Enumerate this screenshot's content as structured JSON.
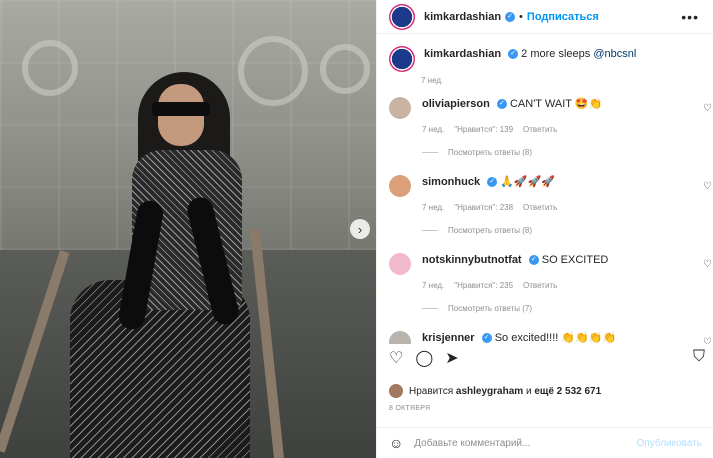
{
  "post": {
    "username": "kimkardashian",
    "follow_label": "Подписаться",
    "more_label": "•••",
    "caption_text": "2 more sleeps",
    "caption_mention": "@nbcsnl",
    "caption_time": "7 нед.",
    "next_arrow": "›"
  },
  "comments": [
    {
      "username": "oliviapierson",
      "text": "CAN'T WAIT 🤩👏",
      "time": "7 нед.",
      "likes": "\"Нравится\": 139",
      "reply": "Ответить",
      "replies": "Посмотреть ответы (8)",
      "avatar_color": "#c9b3a3"
    },
    {
      "username": "simonhuck",
      "text": "🙏🚀🚀🚀",
      "time": "7 нед.",
      "likes": "\"Нравится\": 238",
      "reply": "Ответить",
      "replies": "Посмотреть ответы (8)",
      "avatar_color": "#d9a07a"
    },
    {
      "username": "notskinnybutnotfat",
      "text": "SO EXCITED",
      "time": "7 нед.",
      "likes": "\"Нравится\": 235",
      "reply": "Ответить",
      "replies": "Посмотреть ответы (7)",
      "avatar_color": "#f2b8cc"
    },
    {
      "username": "krisjenner",
      "text": "So excited!!!! 👏👏👏👏",
      "avatar_color": "#b9b3ad"
    }
  ],
  "icons": {
    "heart": "♡",
    "comment": "◯",
    "share": "➤",
    "bookmark": "⛉",
    "emoji": "☺"
  },
  "likes": {
    "prefix": "Нравится",
    "user": "ashleygraham",
    "middle": "и",
    "count": "ещё 2 532 671"
  },
  "date": "8 ОКТЯБРЯ",
  "composer": {
    "placeholder": "Добавьте комментарий...",
    "post_label": "Опубликовать"
  },
  "colors": {
    "accent": "#0095f6",
    "verified": "#3897f0",
    "muted": "#8e8e8e"
  }
}
